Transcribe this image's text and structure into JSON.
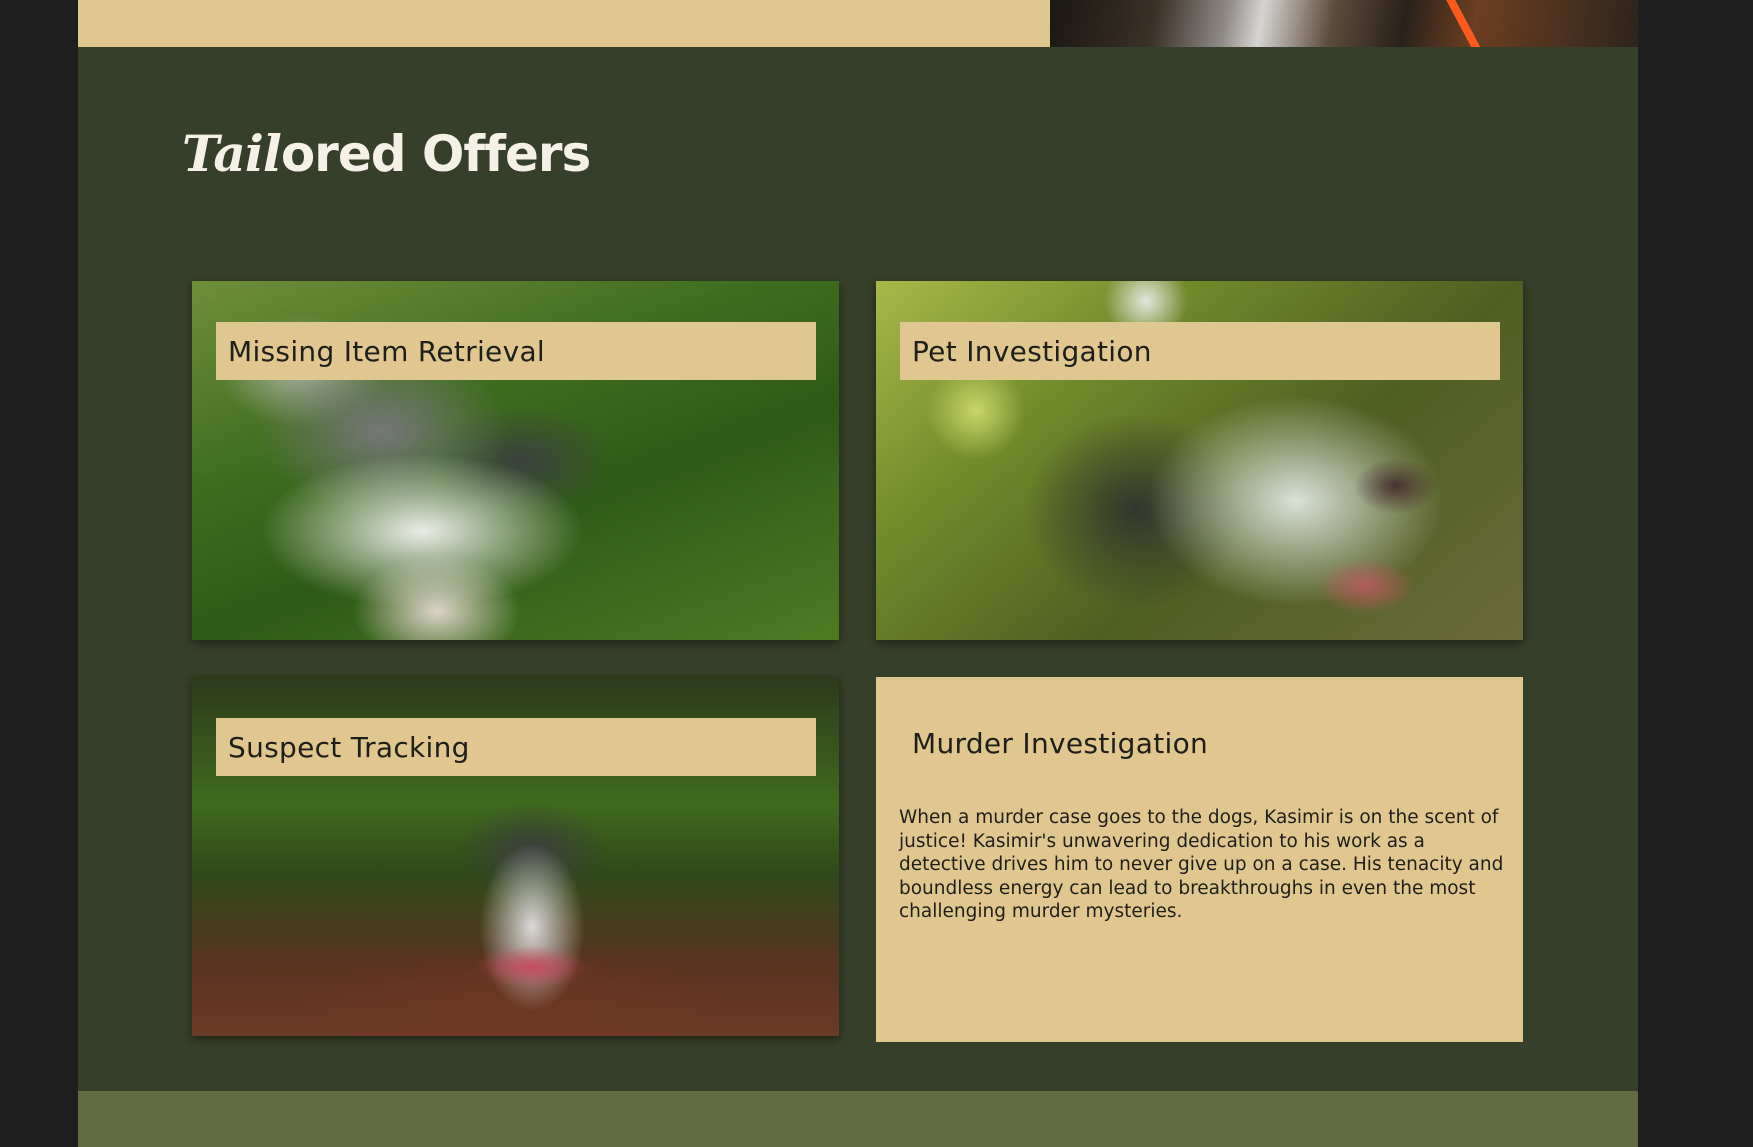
{
  "section": {
    "title_script": "Tail",
    "title_rest": "ored Offers"
  },
  "offers": [
    {
      "label": "Missing Item Retrieval"
    },
    {
      "label": "Pet Investigation"
    },
    {
      "label": "Suspect Tracking"
    },
    {
      "label": "Murder Investigation",
      "description": "When a murder case goes to the dogs, Kasimir is on the scent of justice! Kasimir's unwavering dedication to his work as a detective drives him to never give up on a case. His tenacity and boundless energy can lead to breakthroughs in even the most challenging murder mysteries."
    }
  ],
  "colors": {
    "section_bg": "#363f29",
    "label_bg": "#e0c790",
    "footer_bg": "#636b45",
    "page_bg": "#1e1f1e"
  }
}
